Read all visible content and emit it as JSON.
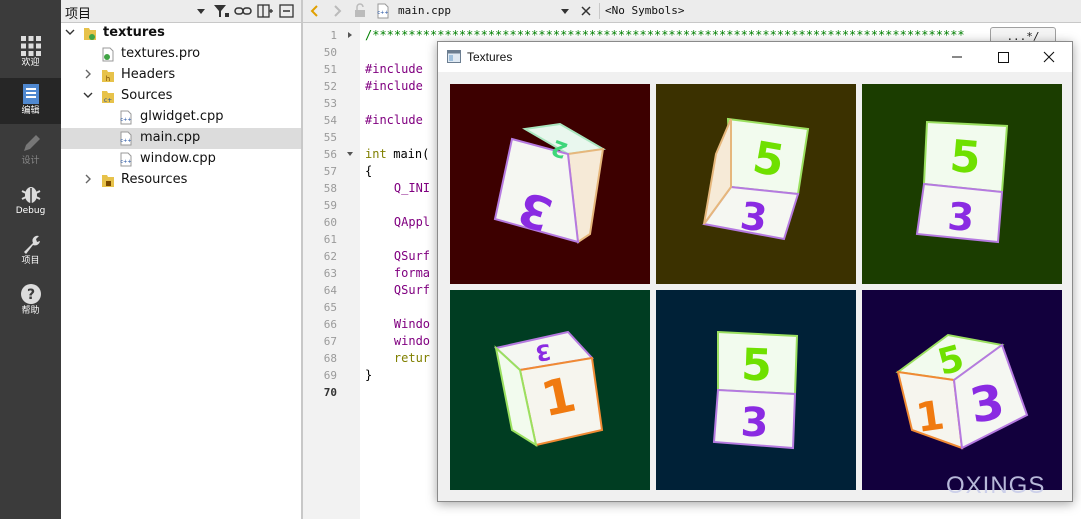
{
  "modebar": {
    "items": [
      {
        "label": "欢迎",
        "icon": "grid-icon"
      },
      {
        "label": "编辑",
        "icon": "document-icon"
      },
      {
        "label": "设计",
        "icon": "pencil-icon"
      },
      {
        "label": "Debug",
        "icon": "bug-icon"
      },
      {
        "label": "项目",
        "icon": "wrench-icon"
      },
      {
        "label": "帮助",
        "icon": "help-icon"
      }
    ]
  },
  "project_panel": {
    "title": "项目",
    "tree": [
      {
        "label": "textures"
      },
      {
        "label": "textures.pro"
      },
      {
        "label": "Headers"
      },
      {
        "label": "Sources"
      },
      {
        "label": "glwidget.cpp"
      },
      {
        "label": "main.cpp"
      },
      {
        "label": "window.cpp"
      },
      {
        "label": "Resources"
      }
    ]
  },
  "editor": {
    "file": "main.cpp",
    "symbols": "<No Symbols>",
    "comment_button": "...*/",
    "line_numbers": [
      "1",
      "50",
      "51",
      "52",
      "53",
      "54",
      "55",
      "56",
      "57",
      "58",
      "59",
      "60",
      "61",
      "62",
      "63",
      "64",
      "65",
      "66",
      "67",
      "68",
      "69",
      "70"
    ],
    "code": {
      "l1": "/**********************************************************************************",
      "l51": "#include",
      "l52": "#include",
      "l54": "#include",
      "l56a": "int",
      "l56b": " main(",
      "l57": "{",
      "l58": "    Q_INI",
      "l60": "    QAppl",
      "l62": "    QSurf",
      "l63": "    forma",
      "l64": "    QSurf",
      "l66": "    Windo",
      "l67": "    windo",
      "l68": "    retur",
      "l69": "}"
    }
  },
  "window": {
    "title": "Textures",
    "tiles": [
      {
        "bg": "#3d0000",
        "front": "3",
        "top": "2"
      },
      {
        "bg": "#3b3100",
        "front": "3",
        "top": "5"
      },
      {
        "bg": "#1b3d00",
        "front": "3",
        "top": "5"
      },
      {
        "bg": "#003d22",
        "front": "1",
        "top": "3"
      },
      {
        "bg": "#002137",
        "front": "3",
        "top": "5"
      },
      {
        "bg": "#12003d",
        "front": "3",
        "top": "5"
      }
    ]
  },
  "watermark": "OXINGS"
}
